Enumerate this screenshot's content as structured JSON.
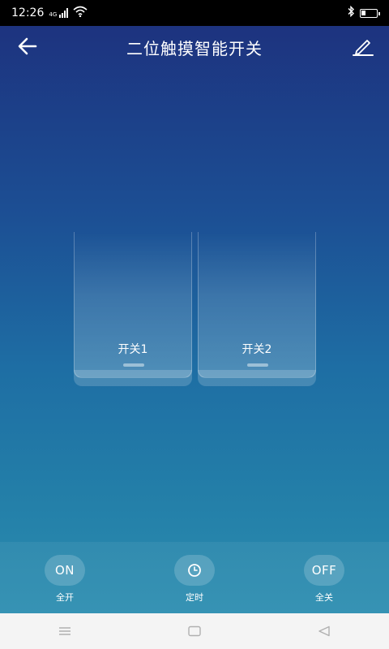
{
  "status_bar": {
    "time": "12:26",
    "network_icon": "signal-4g-icon",
    "wifi_icon": "wifi-icon",
    "bluetooth_icon": "bluetooth-icon",
    "battery_icon": "battery-icon"
  },
  "header": {
    "title": "二位触摸智能开关",
    "back_icon": "arrow-left-icon",
    "edit_icon": "edit-pencil-icon"
  },
  "switches": [
    {
      "label": "开关1"
    },
    {
      "label": "开关2"
    }
  ],
  "controls": {
    "all_on": {
      "button_text": "ON",
      "label": "全开"
    },
    "timer": {
      "icon": "clock-icon",
      "label": "定时"
    },
    "all_off": {
      "button_text": "OFF",
      "label": "全关"
    }
  },
  "nav": {
    "menu_icon": "menu-icon",
    "home_icon": "home-square-icon",
    "back_icon": "back-triangle-icon"
  },
  "colors": {
    "bg_top": "#1d2f7c",
    "bg_bottom": "#2a8db0",
    "nav_bg": "#f4f4f4"
  }
}
